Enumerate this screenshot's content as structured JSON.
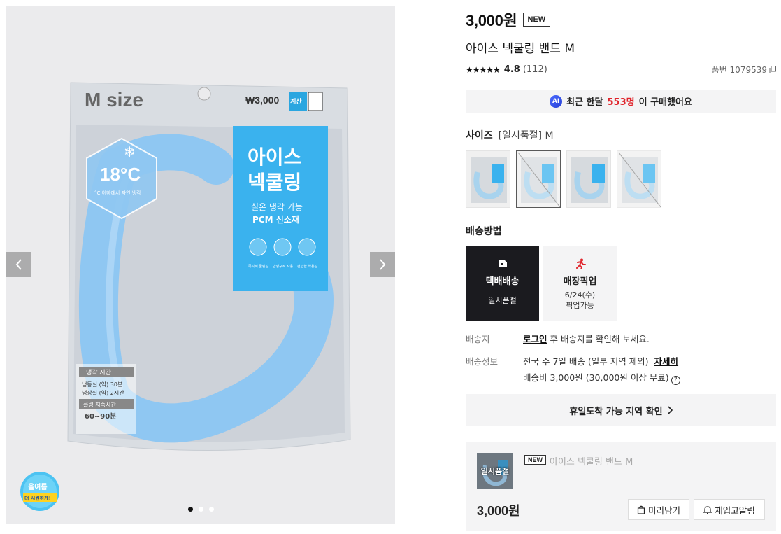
{
  "gallery": {
    "pack_size_text": "M size",
    "pack_price": "₩3,000",
    "pack_tag": "계산",
    "pack_temp": "18°C",
    "pack_temp_sub": "°C 이하에서 자연 냉각",
    "pack_title_1": "아이스",
    "pack_title_2": "넥쿨링",
    "pack_sub_1": "실온 냉각 가능",
    "pack_sub_2": "PCM 신소재",
    "pack_icon_1": "즉각적 쿨링감",
    "pack_icon_2": "반영구적 사용",
    "pack_icon_3": "편안한 착용감",
    "cool_header": "냉각 시간",
    "cool_line_1": "냉동실 (약) 30분",
    "cool_line_2": "냉장실 (약) 2시간",
    "hold_header": "쿨링 지속시간",
    "hold_value": "60~90분",
    "promo_line_1": "올여름",
    "promo_line_2": "더 시원하게!",
    "dots": 3,
    "active_dot": 0
  },
  "product": {
    "price": "3,000원",
    "new_badge": "NEW",
    "title": "아이스 넥쿨링 밴드 M",
    "stars": "★★★★★",
    "rating": "4.8",
    "review_count": "(112)",
    "product_no": "품번 1079539"
  },
  "ai_bar": {
    "icon": "AI",
    "pre": "최근 한달",
    "count": "553명",
    "post": "이 구매했어요"
  },
  "size": {
    "label": "사이즈",
    "value": "[일시품절] M"
  },
  "shipping": {
    "label": "배송방법",
    "options": [
      {
        "name": "택배배송",
        "sub": "일시품절"
      },
      {
        "name": "매장픽업",
        "sub": "6/24(수)",
        "sub2": "픽업가능"
      }
    ]
  },
  "meta": {
    "dest_key": "배송지",
    "login": "로그인",
    "dest_rest": " 후 배송지를 확인해 보세요.",
    "info_key": "배송정보",
    "info_text": "전국 주 7일 배송 (일부 지역 제외)",
    "detail": "자세히",
    "fee": "배송비 3,000원 (30,000원 이상 무료)"
  },
  "holiday": {
    "label": "휴일도착 가능 지역 확인"
  },
  "cart": {
    "soldout": "일시품절",
    "new_badge": "NEW",
    "title": "아이스 넥쿨링 밴드 M",
    "price": "3,000원",
    "wish_label": "미리담기",
    "alarm_label": "재입고알림"
  }
}
